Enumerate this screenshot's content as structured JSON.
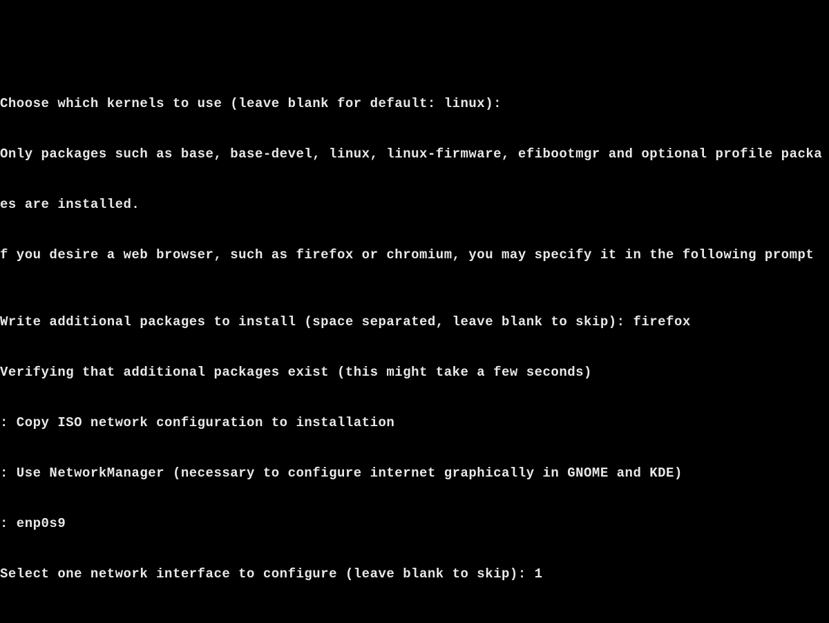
{
  "terminal": {
    "lines": {
      "kernel_prompt": "Choose which kernels to use (leave blank for default: linux):",
      "packages_info1": "Only packages such as base, base-devel, linux, linux-firmware, efibootmgr and optional profile packa",
      "packages_info2": "es are installed.",
      "browser_info": "f you desire a web browser, such as firefox or chromium, you may specify it in the following prompt",
      "additional_prompt": "Write additional packages to install (space separated, leave blank to skip): ",
      "additional_input": "firefox",
      "verifying": "Verifying that additional packages exist (this might take a few seconds)",
      "net_opt0": ": Copy ISO network configuration to installation",
      "net_opt1": ": Use NetworkManager (necessary to configure internet graphically in GNOME and KDE)",
      "net_opt2": ": enp0s9",
      "net_select_prompt": "Select one network interface to configure (leave blank to skip): ",
      "net_select_input": "1"
    }
  }
}
